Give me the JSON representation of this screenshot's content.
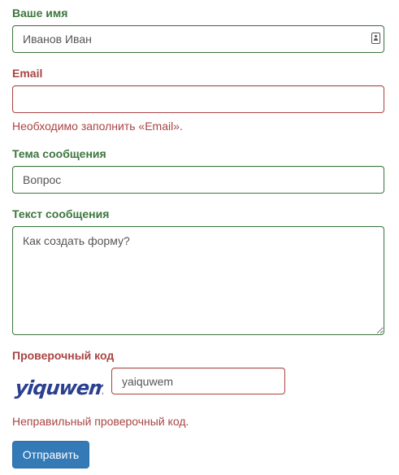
{
  "form": {
    "name": {
      "label": "Ваше имя",
      "value": "Иванов Иван"
    },
    "email": {
      "label": "Email",
      "value": "",
      "error": "Необходимо заполнить «Email»."
    },
    "subject": {
      "label": "Тема сообщения",
      "value": "Вопрос"
    },
    "body": {
      "label": "Текст сообщения",
      "value": "Как создать форму?"
    },
    "captcha": {
      "label": "Проверочный код",
      "image_text": "yiquwem",
      "value": "yaiquwem",
      "error": "Неправильный проверочный код."
    },
    "submit_label": "Отправить"
  },
  "colors": {
    "valid": "#3c763d",
    "invalid": "#a94442",
    "primary": "#337ab7",
    "captcha_text": "#2a3f8f"
  }
}
